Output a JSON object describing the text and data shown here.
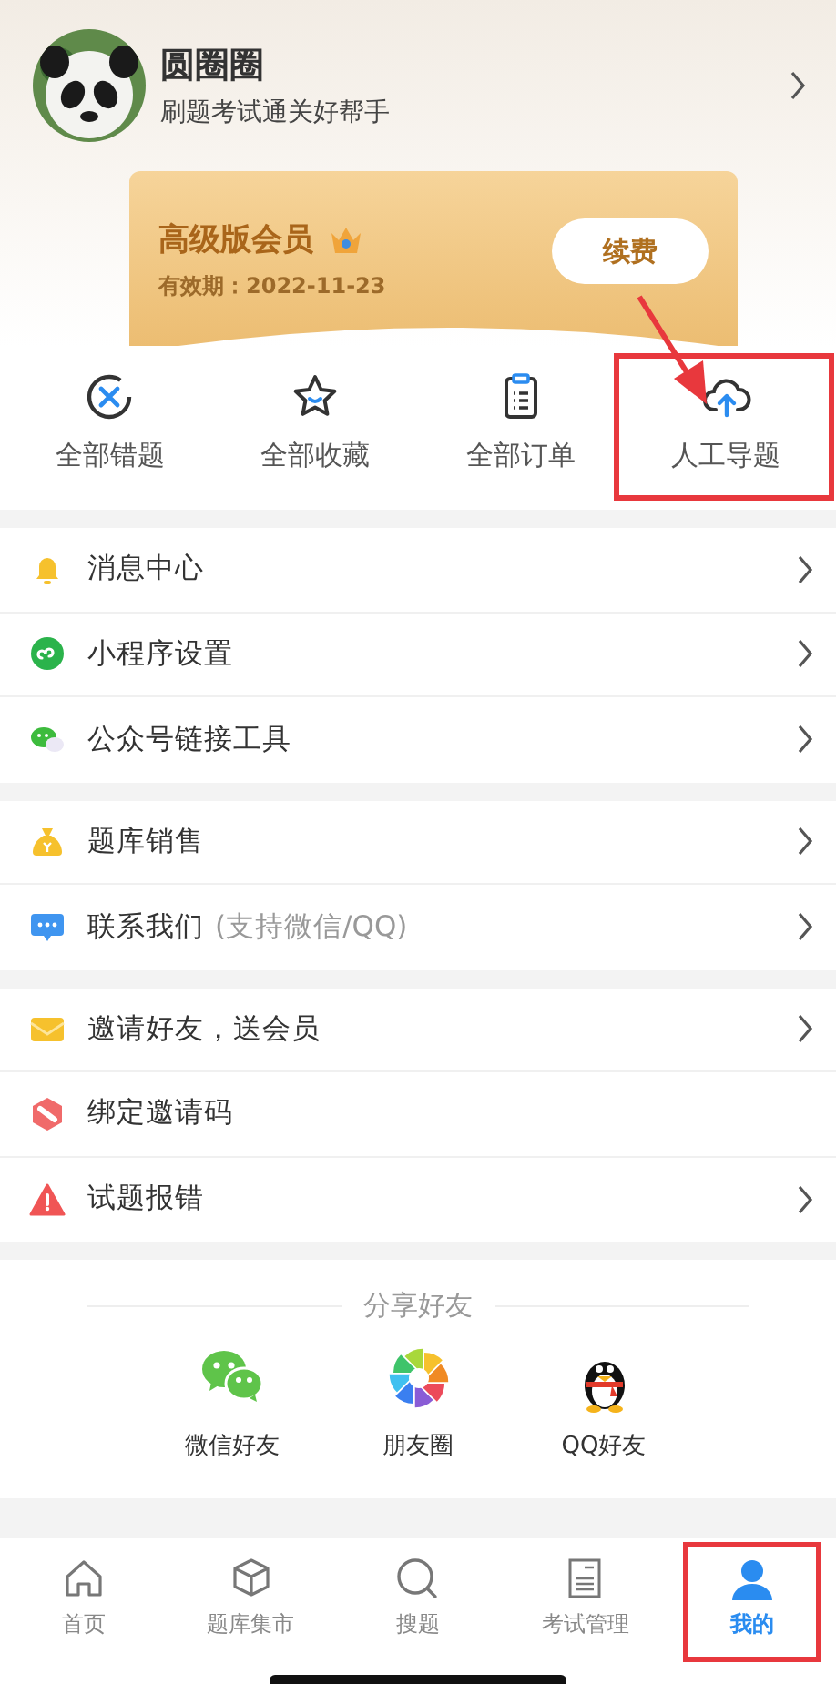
{
  "profile": {
    "name": "圆圈圈",
    "subtitle": "刷题考试通关好帮手"
  },
  "membership": {
    "title": "高级版会员",
    "expiry_label": "有效期：",
    "expiry": "2022-11-23",
    "renew_button": "续费",
    "arrow_to_highlight": true
  },
  "quick_actions": [
    {
      "kind": "wrong",
      "label": "全部错题",
      "highlighted": false
    },
    {
      "kind": "favorites",
      "label": "全部收藏",
      "highlighted": false
    },
    {
      "kind": "orders",
      "label": "全部订单",
      "highlighted": false
    },
    {
      "kind": "upload",
      "label": "人工导题",
      "highlighted": true
    }
  ],
  "menu_groups": [
    [
      {
        "kind": "bell",
        "label": "消息中心",
        "chevron": true
      },
      {
        "kind": "miniapp",
        "label": "小程序设置",
        "chevron": true
      },
      {
        "kind": "wechat",
        "label": "公众号链接工具",
        "chevron": true
      }
    ],
    [
      {
        "kind": "bag",
        "label": "题库销售",
        "chevron": true
      },
      {
        "kind": "chat",
        "label": "联系我们",
        "hint": "(支持微信/QQ)",
        "chevron": true
      }
    ],
    [
      {
        "kind": "envelope",
        "label": "邀请好友，送会员",
        "chevron": true
      },
      {
        "kind": "tag",
        "label": "绑定邀请码",
        "chevron": false
      },
      {
        "kind": "warning",
        "label": "试题报错",
        "chevron": true
      }
    ]
  ],
  "share": {
    "title": "分享好友",
    "targets": [
      {
        "kind": "wechat",
        "label": "微信好友"
      },
      {
        "kind": "moments",
        "label": "朋友圈"
      },
      {
        "kind": "qq",
        "label": "QQ好友"
      }
    ]
  },
  "tab_bar": [
    {
      "kind": "home",
      "label": "首页",
      "selected": false,
      "highlighted": false
    },
    {
      "kind": "market",
      "label": "题库集市",
      "selected": false,
      "highlighted": false
    },
    {
      "kind": "search",
      "label": "搜题",
      "selected": false,
      "highlighted": false
    },
    {
      "kind": "exam",
      "label": "考试管理",
      "selected": false,
      "highlighted": false
    },
    {
      "kind": "mine",
      "label": "我的",
      "selected": true,
      "highlighted": true
    }
  ]
}
